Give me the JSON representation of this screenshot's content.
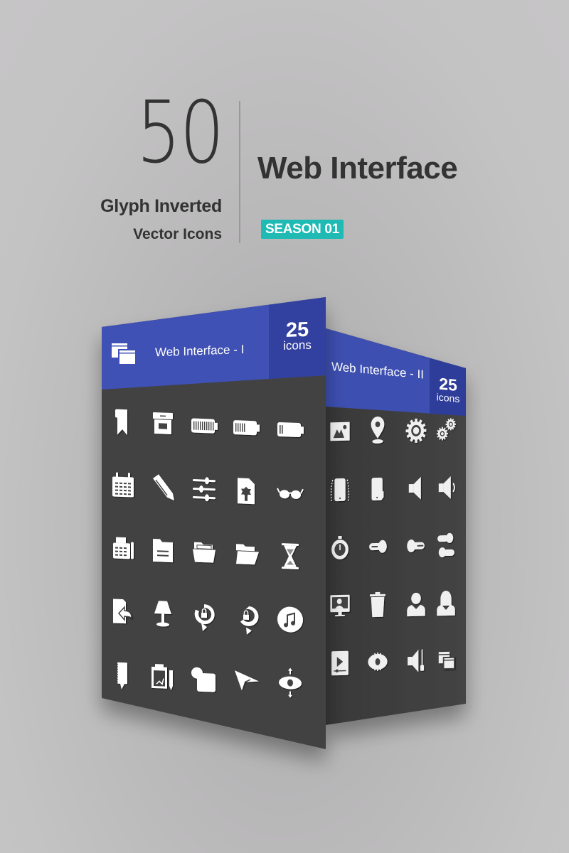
{
  "header": {
    "count": "50",
    "style_line_1": "Glyph Inverted",
    "style_line_2": "Vector Icons",
    "title": "Web Interface",
    "badge": "SEASON 01"
  },
  "colors": {
    "header_blue": "#3f51b5",
    "count_blue": "#303f9f",
    "panel_dark": "#424242",
    "badge_teal": "#1fbab4",
    "text_dark": "#333333"
  },
  "packs": [
    {
      "name": "Web Interface - I",
      "count": "25",
      "count_label": "icons",
      "header_icon": "windows-icon",
      "icons": [
        "bookmark-icon",
        "archive-box-icon",
        "battery-full-icon",
        "battery-half-icon",
        "battery-low-icon",
        "calendar-icon",
        "pencil-icon",
        "sliders-icon",
        "certificate-file-icon",
        "glasses-icon",
        "fax-icon",
        "document-folder-icon",
        "open-folder-icon",
        "open-folder-alt-icon",
        "hourglass-icon",
        "exit-door-icon",
        "lamp-icon",
        "rotate-lock-icon",
        "rotate-lock-alt-icon",
        "music-icon",
        "notepad-icon",
        "clipboard-pencil-icon",
        "shape-icon",
        "paper-plane-icon",
        "vertical-view-icon"
      ]
    },
    {
      "name": "Web Interface - II",
      "count": "25",
      "count_label": "icons",
      "icons": [
        "image-icon",
        "map-pin-icon",
        "gear-icon",
        "gears-icon",
        "phone-shake-icon",
        "hand-phone-icon",
        "speaker-icon",
        "speaker-volume-icon",
        "stopwatch-icon",
        "toggle-off-icon",
        "toggle-on-icon",
        "toggles-icon",
        "video-call-icon",
        "trash-icon",
        "male-user-icon",
        "female-user-icon",
        "video-player-icon",
        "eye-icon",
        "volume-slider-icon",
        "windows-icon"
      ]
    }
  ]
}
